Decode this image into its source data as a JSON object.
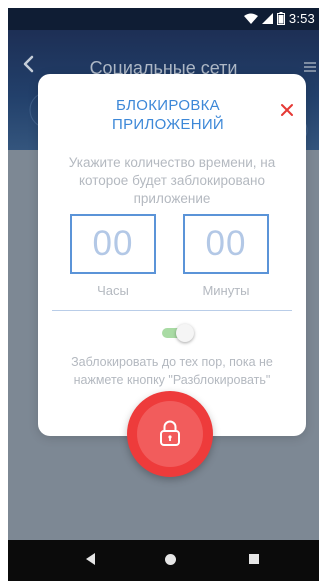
{
  "status_bar": {
    "time": "3:53",
    "icons": [
      "wifi-icon",
      "signal-icon",
      "battery-icon"
    ]
  },
  "header": {
    "title": "Социальные сети",
    "back_icon": "chevron-left-icon",
    "menu_icon": "menu-icon"
  },
  "dialog": {
    "title": "БЛОКИРОВКА ПРИЛОЖЕНИЙ",
    "close_icon": "close-icon",
    "instruction": "Укажите количество времени, на которое будет заблокировано приложение",
    "hours": {
      "value": "00",
      "label": "Часы"
    },
    "minutes": {
      "value": "00",
      "label": "Минуты"
    },
    "toggle_on": true,
    "block_note": "Заблокировать до тех пор, пока не нажмете кнопку \"Разблокировать\"",
    "lock_button_icon": "lock-icon"
  },
  "nav_bar": {
    "icons": [
      "back-icon",
      "home-icon",
      "recents-icon"
    ]
  },
  "colors": {
    "accent_blue": "#3d88d8",
    "close_red": "#e53935",
    "lock_red": "#ee3b3b",
    "toggle_green": "#a9dba4"
  }
}
